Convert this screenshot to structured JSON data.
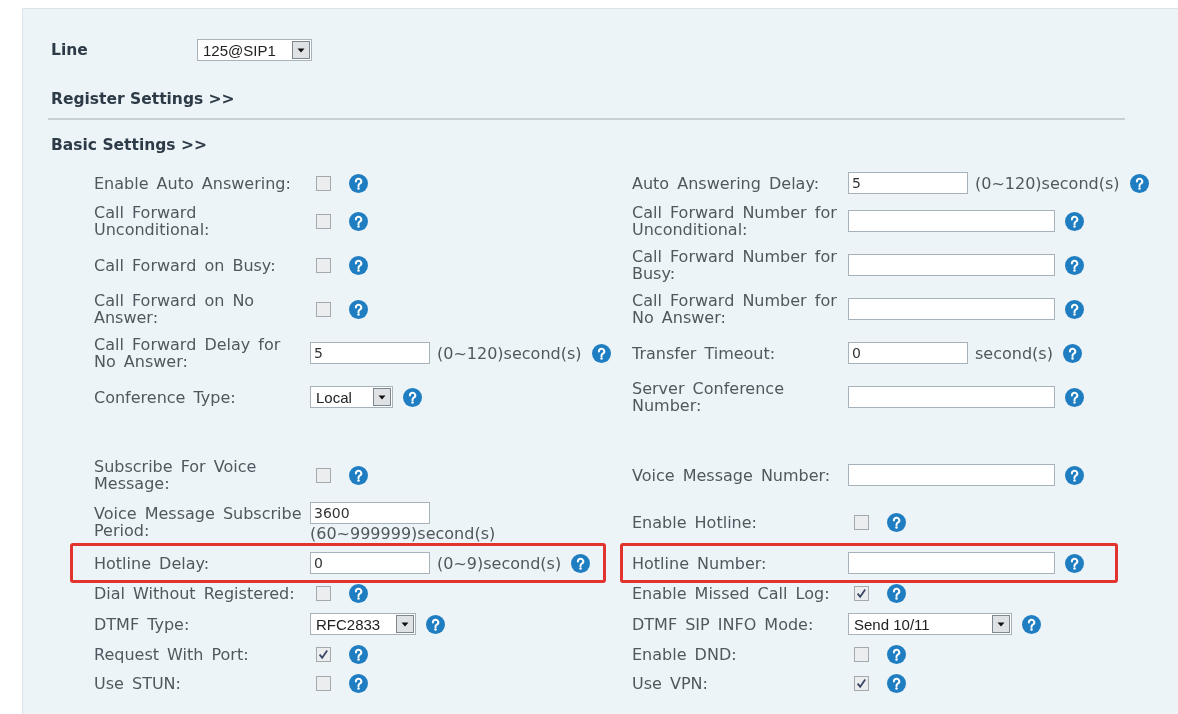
{
  "line": {
    "label": "Line",
    "value": "125@SIP1"
  },
  "register_settings": {
    "title": "Register Settings >>"
  },
  "basic_settings": {
    "title": "Basic Settings >>",
    "rows": [
      {
        "left": {
          "kind": "checkbox",
          "label": "Enable Auto Answering:",
          "checked": false,
          "help": true,
          "highlighted": false
        },
        "right": {
          "kind": "text",
          "label": "Auto Answering Delay:",
          "value": "5",
          "suffix": "(0~120)second(s)",
          "suffix_below": false,
          "help": true,
          "highlighted": false
        }
      },
      {
        "left": {
          "kind": "checkbox",
          "label": "Call Forward Unconditional:",
          "checked": false,
          "help": true,
          "highlighted": false
        },
        "right": {
          "kind": "text",
          "label": "Call Forward Number for Unconditional:",
          "help": true,
          "highlighted": false
        }
      },
      {
        "left": {
          "kind": "checkbox",
          "label": "Call Forward on Busy:",
          "checked": false,
          "help": true,
          "highlighted": false
        },
        "right": {
          "kind": "text",
          "label": "Call Forward Number for Busy:",
          "help": true,
          "highlighted": false
        }
      },
      {
        "left": {
          "kind": "checkbox",
          "label": "Call Forward on No Answer:",
          "checked": false,
          "help": true,
          "highlighted": false
        },
        "right": {
          "kind": "text",
          "label": "Call Forward Number for No Answer:",
          "help": true,
          "highlighted": false
        }
      },
      {
        "left": {
          "kind": "text",
          "label": "Call Forward Delay for No Answer:",
          "value": "5",
          "suffix": "(0~120)second(s)",
          "suffix_below": false,
          "help": true,
          "highlighted": false
        },
        "right": {
          "kind": "text",
          "label": "Transfer Timeout:",
          "value": "0",
          "suffix": "second(s)",
          "suffix_below": false,
          "help": true,
          "highlighted": false
        }
      },
      {
        "left": {
          "kind": "select",
          "label": "Conference Type:",
          "value": "Local",
          "help": true,
          "highlighted": false
        },
        "right": {
          "kind": "text",
          "label": "Server Conference Number:",
          "help": true,
          "highlighted": false
        }
      },
      {
        "left": {
          "kind": "checkbox",
          "label": "Subscribe For Voice Message:",
          "checked": false,
          "help": true,
          "highlighted": false
        },
        "right": {
          "kind": "text",
          "label": "Voice Message Number:",
          "help": true,
          "highlighted": false
        }
      },
      {
        "left": {
          "kind": "text",
          "label": "Voice Message Subscribe Period:",
          "value": "3600",
          "suffix": "(60~999999)second(s)",
          "suffix_below": true,
          "help": false,
          "highlighted": false
        },
        "right": {
          "kind": "checkbox",
          "label": "Enable Hotline:",
          "checked": false,
          "help": true,
          "highlighted": false
        }
      },
      {
        "left": {
          "kind": "text",
          "label": "Hotline Delay:",
          "value": "0",
          "suffix": "(0~9)second(s)",
          "suffix_below": false,
          "help": true,
          "highlighted": true
        },
        "right": {
          "kind": "text",
          "label": "Hotline Number:",
          "help": true,
          "highlighted": true
        }
      },
      {
        "left": {
          "kind": "checkbox",
          "label": "Dial Without Registered:",
          "checked": false,
          "help": true,
          "highlighted": false
        },
        "right": {
          "kind": "checkbox",
          "label": "Enable Missed Call Log:",
          "checked": true,
          "help": true,
          "highlighted": false
        }
      },
      {
        "left": {
          "kind": "select",
          "label": "DTMF Type:",
          "value": "RFC2833",
          "help": true,
          "highlighted": false
        },
        "right": {
          "kind": "select",
          "label": "DTMF SIP INFO Mode:",
          "value": "Send 10/11",
          "help": true,
          "highlighted": false
        }
      },
      {
        "left": {
          "kind": "checkbox",
          "label": "Request With Port:",
          "checked": true,
          "help": true,
          "highlighted": false
        },
        "right": {
          "kind": "checkbox",
          "label": "Enable DND:",
          "checked": false,
          "help": true,
          "highlighted": false
        }
      },
      {
        "left": {
          "kind": "checkbox",
          "label": "Use STUN:",
          "checked": false,
          "help": true,
          "highlighted": false
        },
        "right": {
          "kind": "checkbox",
          "label": "Use VPN:",
          "checked": true,
          "help": true,
          "highlighted": false
        }
      }
    ]
  }
}
